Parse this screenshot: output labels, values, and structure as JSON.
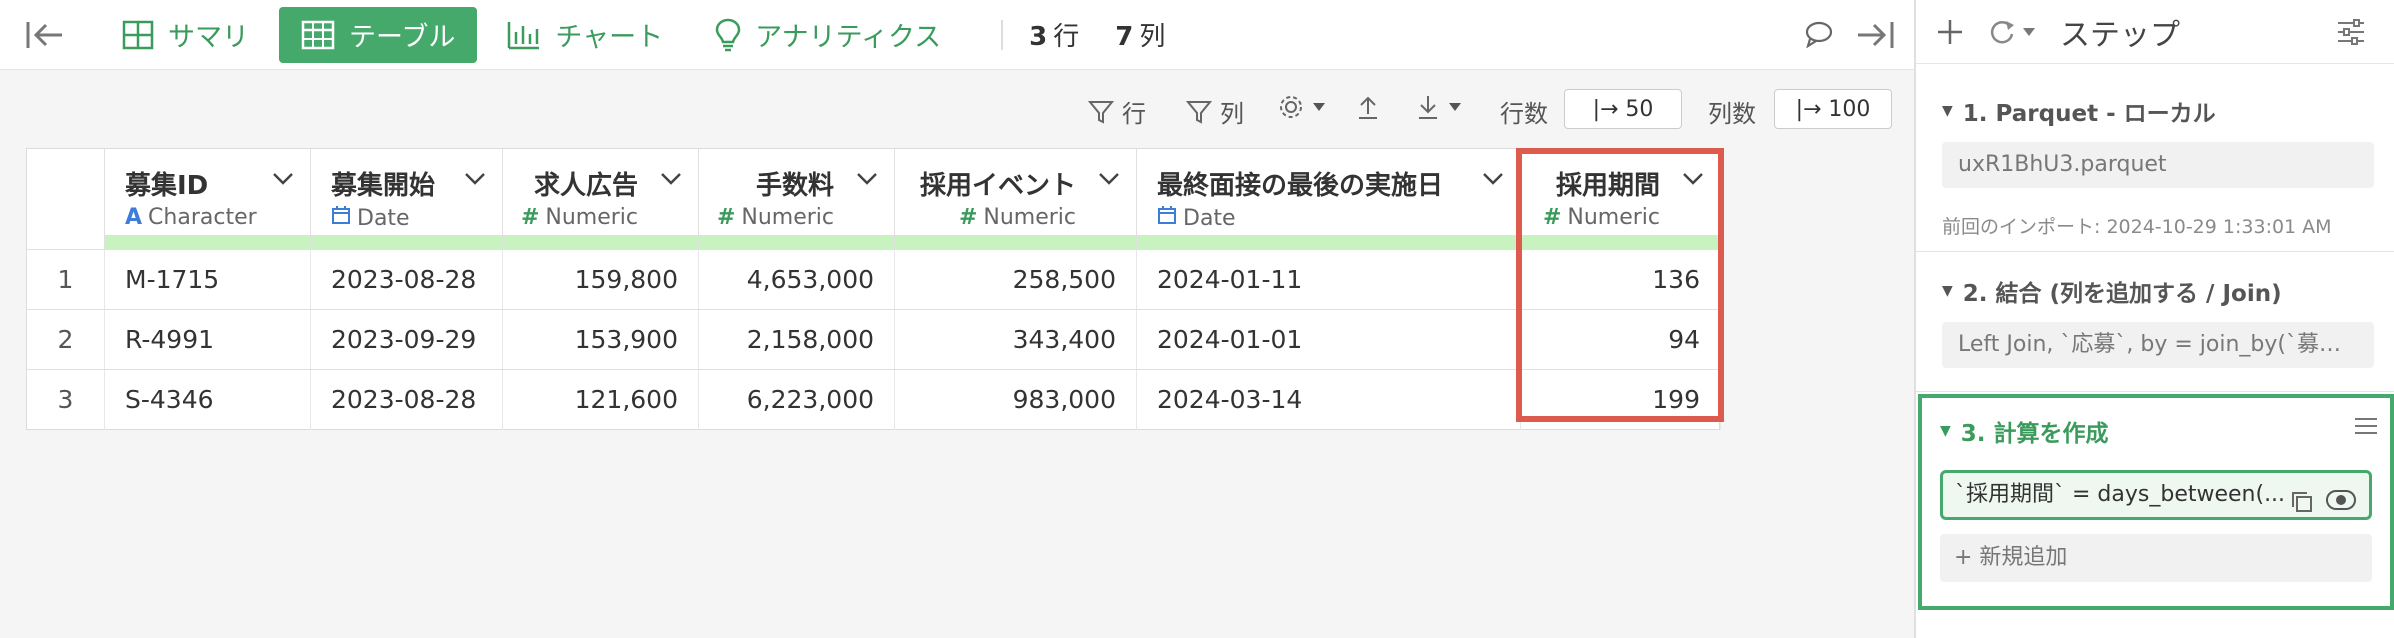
{
  "topbar": {
    "tabs": [
      {
        "label": "サマリ",
        "icon": "summary-grid-icon"
      },
      {
        "label": "テーブル",
        "icon": "table-icon",
        "active": true
      },
      {
        "label": "チャート",
        "icon": "bar-chart-icon"
      },
      {
        "label": "アナリティクス",
        "icon": "lightbulb-icon"
      }
    ],
    "rows_count": "3",
    "rows_unit": "行",
    "cols_count": "7",
    "cols_unit": "列"
  },
  "toolbar": {
    "filter_rows_label": "行",
    "filter_cols_label": "列",
    "row_limit_label": "行数",
    "row_limit_value": "|→ 50",
    "col_limit_label": "列数",
    "col_limit_value": "|→ 100"
  },
  "table": {
    "columns": [
      {
        "name": "募集ID",
        "type": "Character",
        "type_icon": "A"
      },
      {
        "name": "募集開始",
        "type": "Date",
        "type_icon": "calendar"
      },
      {
        "name": "求人広告",
        "type": "Numeric",
        "type_icon": "#"
      },
      {
        "name": "手数料",
        "type": "Numeric",
        "type_icon": "#"
      },
      {
        "name": "採用イベント",
        "type": "Numeric",
        "type_icon": "#"
      },
      {
        "name": "最終面接の最後の実施日",
        "type": "Date",
        "type_icon": "calendar"
      },
      {
        "name": "採用期間",
        "type": "Numeric",
        "type_icon": "#"
      }
    ],
    "rows": [
      [
        "1",
        "M-1715",
        "2023-08-28",
        "159,800",
        "4,653,000",
        "258,500",
        "2024-01-11",
        "136"
      ],
      [
        "2",
        "R-4991",
        "2023-09-29",
        "153,900",
        "2,158,000",
        "343,400",
        "2024-01-01",
        "94"
      ],
      [
        "3",
        "S-4346",
        "2023-08-28",
        "121,600",
        "6,223,000",
        "983,000",
        "2024-03-14",
        "199"
      ]
    ]
  },
  "panel": {
    "title": "ステップ",
    "steps": [
      {
        "title": "1. Parquet - ローカル",
        "value": "uxR1BhU3.parquet",
        "meta": "前回のインポート: 2024-10-29 1:33:01 AM"
      },
      {
        "title": "2. 結合 (列を追加する / Join)",
        "value": "Left Join, `応募`, by = join_by(`募集I..."
      },
      {
        "title": "3. 計算を作成",
        "value": "`採用期間` = days_between(...",
        "add_new": "+ 新規追加"
      }
    ]
  },
  "colors": {
    "accent": "#45a96b",
    "highlight": "#dd5a4f",
    "type_bar": "#c8f2bf"
  }
}
